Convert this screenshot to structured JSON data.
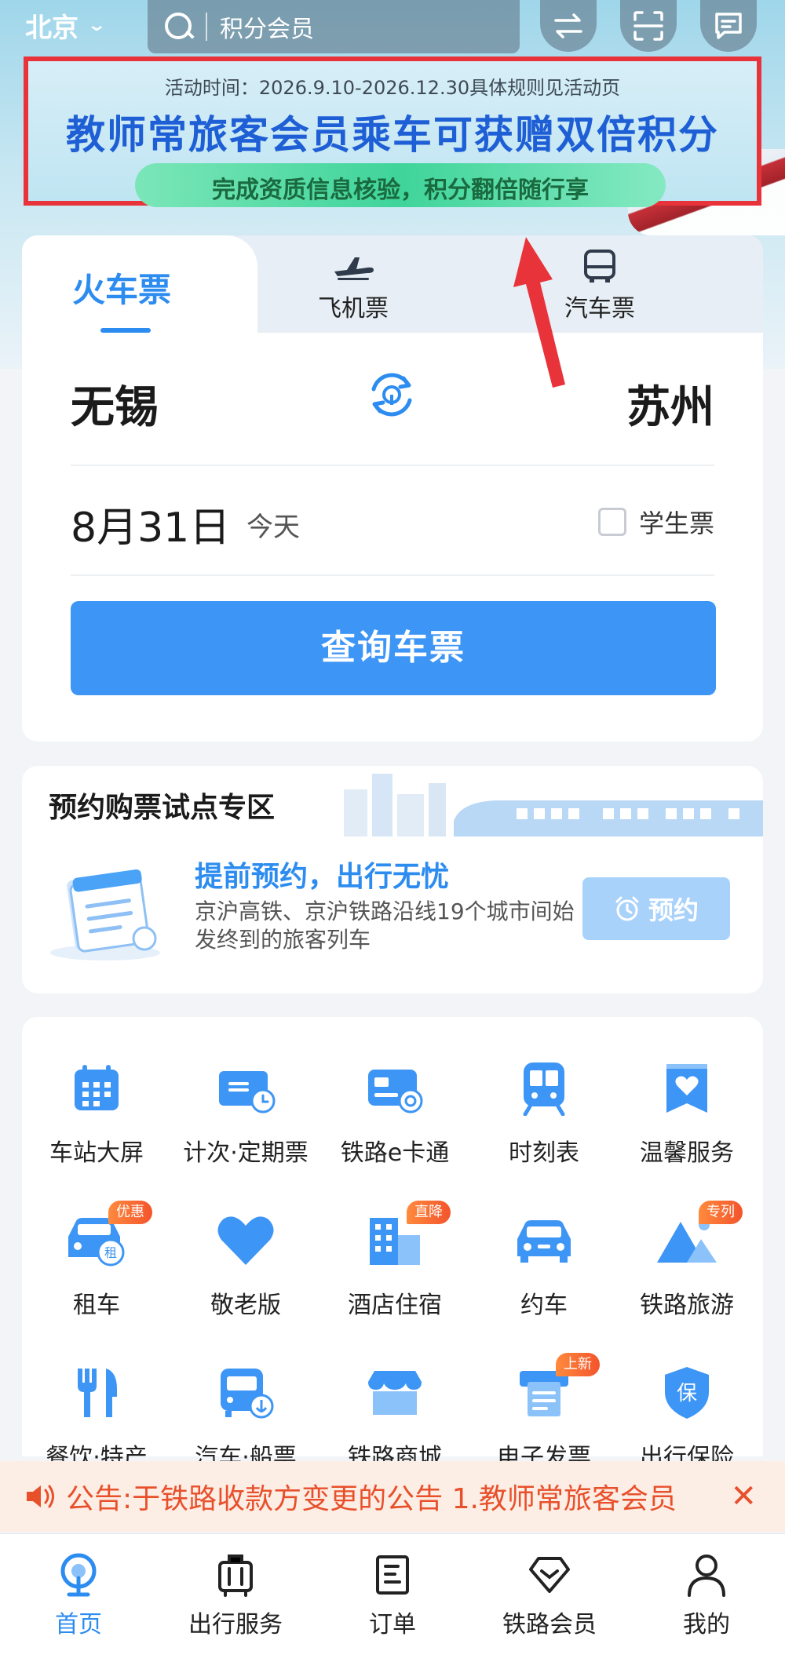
{
  "topbar": {
    "city": "北京",
    "search_placeholder": "积分会员"
  },
  "banner": {
    "period": "活动时间：2026.9.10-2026.12.30具体规则见活动页",
    "headline": "教师常旅客会员乘车可获赠双倍积分",
    "subline": "完成资质信息核验，积分翻倍随行享"
  },
  "ticket": {
    "tabs": [
      {
        "label": "火车票",
        "active": true
      },
      {
        "label": "飞机票",
        "active": false
      },
      {
        "label": "汽车票",
        "active": false
      }
    ],
    "from_station": "无锡",
    "to_station": "苏州",
    "date": "8月31日",
    "date_hint": "今天",
    "student_label": "学生票",
    "student_checked": false,
    "query_label": "查询车票"
  },
  "booking": {
    "title": "预约购票试点专区",
    "headline": "提前预约，出行无忧",
    "description": "京沪高铁、京沪铁路沿线19个城市间始发终到的旅客列车",
    "button_label": "预约"
  },
  "services": [
    {
      "label": "车站大屏",
      "icon": "calendar-grid-icon",
      "badge": ""
    },
    {
      "label": "计次·定期票",
      "icon": "timed-ticket-icon",
      "badge": ""
    },
    {
      "label": "铁路e卡通",
      "icon": "e-card-icon",
      "badge": ""
    },
    {
      "label": "时刻表",
      "icon": "train-front-icon",
      "badge": ""
    },
    {
      "label": "温馨服务",
      "icon": "heart-bookmark-icon",
      "badge": ""
    },
    {
      "label": "租车",
      "icon": "car-rental-icon",
      "badge": "优惠"
    },
    {
      "label": "敬老版",
      "icon": "heart-icon",
      "badge": ""
    },
    {
      "label": "酒店住宿",
      "icon": "hotel-building-icon",
      "badge": "直降"
    },
    {
      "label": "约车",
      "icon": "car-icon",
      "badge": ""
    },
    {
      "label": "铁路旅游",
      "icon": "mountain-icon",
      "badge": "专列"
    },
    {
      "label": "餐饮·特产",
      "icon": "cutlery-icon",
      "badge": ""
    },
    {
      "label": "汽车·船票",
      "icon": "bus-anchor-icon",
      "badge": ""
    },
    {
      "label": "铁路商城",
      "icon": "shop-icon",
      "badge": ""
    },
    {
      "label": "电子发票",
      "icon": "invoice-printer-icon",
      "badge": "上新"
    },
    {
      "label": "出行保险",
      "icon": "insurance-shield-icon",
      "badge": ""
    }
  ],
  "notice": {
    "label": "公告:",
    "text": "于铁路收款方变更的公告   1.教师常旅客会员"
  },
  "bottom_nav": [
    {
      "label": "首页",
      "active": true
    },
    {
      "label": "出行服务",
      "active": false
    },
    {
      "label": "订单",
      "active": false
    },
    {
      "label": "铁路会员",
      "active": false
    },
    {
      "label": "我的",
      "active": false
    }
  ],
  "colors": {
    "accent": "#2d8cf0",
    "button": "#3d95f5",
    "highlight_border": "#e8333a",
    "notice_text": "#e8502c"
  }
}
